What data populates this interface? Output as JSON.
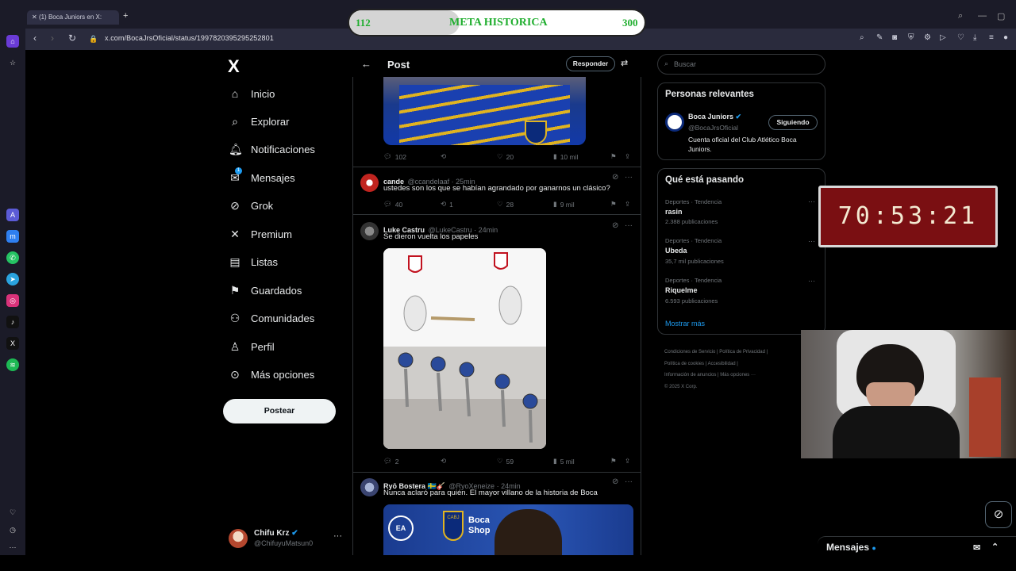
{
  "browser": {
    "tab_title": "(1) Boca Juniors en X:",
    "url": "x.com/BocaJrsOficial/status/1997820395295252801",
    "new_tab": "+"
  },
  "meta_overlay": {
    "current": "112",
    "label": "META HISTORICA",
    "target": "300",
    "progress_fraction": 0.373
  },
  "timer_overlay": {
    "value": "70:53:21"
  },
  "left_nav": {
    "logo": "X",
    "items": [
      {
        "label": "Inicio",
        "icon": "home-icon"
      },
      {
        "label": "Explorar",
        "icon": "search-icon"
      },
      {
        "label": "Notificaciones",
        "icon": "bell-icon"
      },
      {
        "label": "Mensajes",
        "icon": "mail-icon"
      },
      {
        "label": "Grok",
        "icon": "grok-icon"
      },
      {
        "label": "Premium",
        "icon": "x-icon"
      },
      {
        "label": "Listas",
        "icon": "list-icon"
      },
      {
        "label": "Guardados",
        "icon": "bookmark-icon"
      },
      {
        "label": "Comunidades",
        "icon": "people-icon"
      },
      {
        "label": "Perfil",
        "icon": "person-icon"
      },
      {
        "label": "Más opciones",
        "icon": "more-icon"
      }
    ],
    "post_button": "Postear",
    "messages_badge": "1",
    "account": {
      "name": "Chifu Krz",
      "handle": "@ChifuyuMatsun0"
    }
  },
  "feed": {
    "header_title": "Post",
    "reply_button": "Responder",
    "first_stats": {
      "replies": "102",
      "retweets": "",
      "likes": "20",
      "views": "10 mil"
    },
    "tweets": [
      {
        "name": "cande",
        "handle": "@ccandelaaf",
        "time": "25min",
        "text": "ustedes son los que se habían agrandado por ganarnos un clásico?",
        "replies": "40",
        "retweets": "1",
        "likes": "28",
        "views": "9 mil"
      },
      {
        "name": "Luke Castru",
        "handle": "@LukeCastru",
        "time": "24min",
        "text": "Se dieron vuelta los papeles",
        "replies": "2",
        "retweets": "",
        "likes": "59",
        "views": "5 mil"
      },
      {
        "name": "Ryō Bostera 🇸🇪🎸",
        "handle": "@RyoXeneize",
        "time": "24min",
        "text": "Nunca aclaró para quién. El mayor villano de la historia de Boca"
      }
    ],
    "ad_text": {
      "brand": "EA SPORTS",
      "shop": "Boca Shop",
      "crest": "CABJ"
    }
  },
  "right": {
    "search_placeholder": "Buscar",
    "relevant": {
      "title": "Personas relevantes",
      "name": "Boca Juniors",
      "handle": "@BocaJrsOficial",
      "follow_label": "Siguiendo",
      "bio": "Cuenta oficial del Club Atlético Boca Juniors."
    },
    "trends": {
      "title": "Qué está pasando",
      "items": [
        {
          "category": "Deportes · Tendencia",
          "name": "rasin",
          "count": "2.388 publicaciones"
        },
        {
          "category": "Deportes · Tendencia",
          "name": "Ubeda",
          "count": "35,7 mil publicaciones"
        },
        {
          "category": "Deportes · Tendencia",
          "name": "Riquelme",
          "count": "6.593 publicaciones"
        }
      ],
      "show_more": "Mostrar más"
    },
    "footer": {
      "l1a": "Condiciones de Servicio",
      "l1b": "Política de Privacidad",
      "l2a": "Política de cookies",
      "l2b": "Accesibilidad",
      "l3a": "Información de anuncios",
      "l3b": "Más opciones ···",
      "copy": "© 2025 X Corp."
    }
  },
  "messages_bar": {
    "label": "Mensajes"
  },
  "colors": {
    "accent": "#1d9bf0",
    "meta_green": "#1fae2e",
    "timer_red": "#7a0f12"
  }
}
